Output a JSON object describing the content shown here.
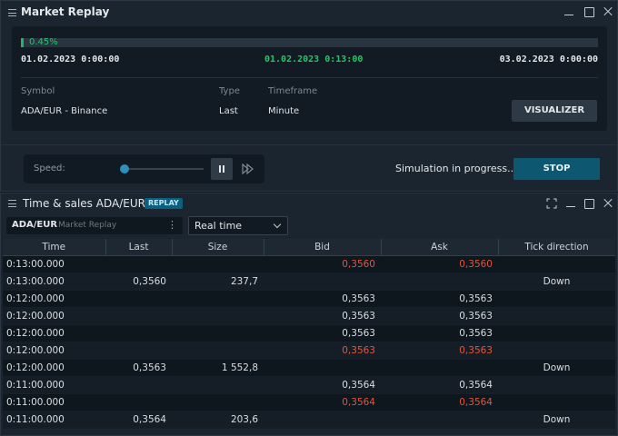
{
  "market_replay": {
    "title": "Market Replay",
    "progress": {
      "percent_label": "0.45%",
      "fraction": 0.0045
    },
    "time_start": "01.02.2023 0:00:00",
    "time_current": "01.02.2023 0:13:00",
    "time_end": "03.02.2023 0:00:00",
    "headers": {
      "symbol": "Symbol",
      "type": "Type",
      "timeframe": "Timeframe"
    },
    "values": {
      "symbol": "ADA/EUR - Binance",
      "type": "Last",
      "timeframe": "Minute"
    },
    "visualizer_label": "VISUALIZER",
    "speed_label": "Speed:",
    "speed_level": 0.0,
    "status_text": "Simulation in progress...",
    "stop_label": "STOP"
  },
  "time_sales": {
    "title": "Time & sales ADA/EUR",
    "badge": "REPLAY",
    "symbol": "ADA/EUR",
    "symbol_source": "Market Replay",
    "mode": "Real time",
    "columns": [
      "Time",
      "Last",
      "Size",
      "Bid",
      "Ask",
      "Tick direction"
    ],
    "rows": [
      {
        "time": "0:13:00.000",
        "last": "",
        "size": "",
        "bid": "0,3560",
        "ask": "0,3560",
        "tick": "",
        "red": true
      },
      {
        "time": "0:13:00.000",
        "last": "0,3560",
        "size": "237,7",
        "bid": "",
        "ask": "",
        "tick": "Down",
        "red": false
      },
      {
        "time": "0:12:00.000",
        "last": "",
        "size": "",
        "bid": "0,3563",
        "ask": "0,3563",
        "tick": "",
        "red": false
      },
      {
        "time": "0:12:00.000",
        "last": "",
        "size": "",
        "bid": "0,3563",
        "ask": "0,3563",
        "tick": "",
        "red": false
      },
      {
        "time": "0:12:00.000",
        "last": "",
        "size": "",
        "bid": "0,3563",
        "ask": "0,3563",
        "tick": "",
        "red": false
      },
      {
        "time": "0:12:00.000",
        "last": "",
        "size": "",
        "bid": "0,3563",
        "ask": "0,3563",
        "tick": "",
        "red": true
      },
      {
        "time": "0:12:00.000",
        "last": "0,3563",
        "size": "1 552,8",
        "bid": "",
        "ask": "",
        "tick": "Down",
        "red": false
      },
      {
        "time": "0:11:00.000",
        "last": "",
        "size": "",
        "bid": "0,3564",
        "ask": "0,3564",
        "tick": "",
        "red": false
      },
      {
        "time": "0:11:00.000",
        "last": "",
        "size": "",
        "bid": "0,3564",
        "ask": "0,3564",
        "tick": "",
        "red": true
      },
      {
        "time": "0:11:00.000",
        "last": "0,3564",
        "size": "203,6",
        "bid": "",
        "ask": "",
        "tick": "Down",
        "red": false
      }
    ]
  },
  "colors": {
    "accent": "#0e5770",
    "progress": "#26b364",
    "sell_red": "#e4553b",
    "panel": "#1b2530"
  }
}
